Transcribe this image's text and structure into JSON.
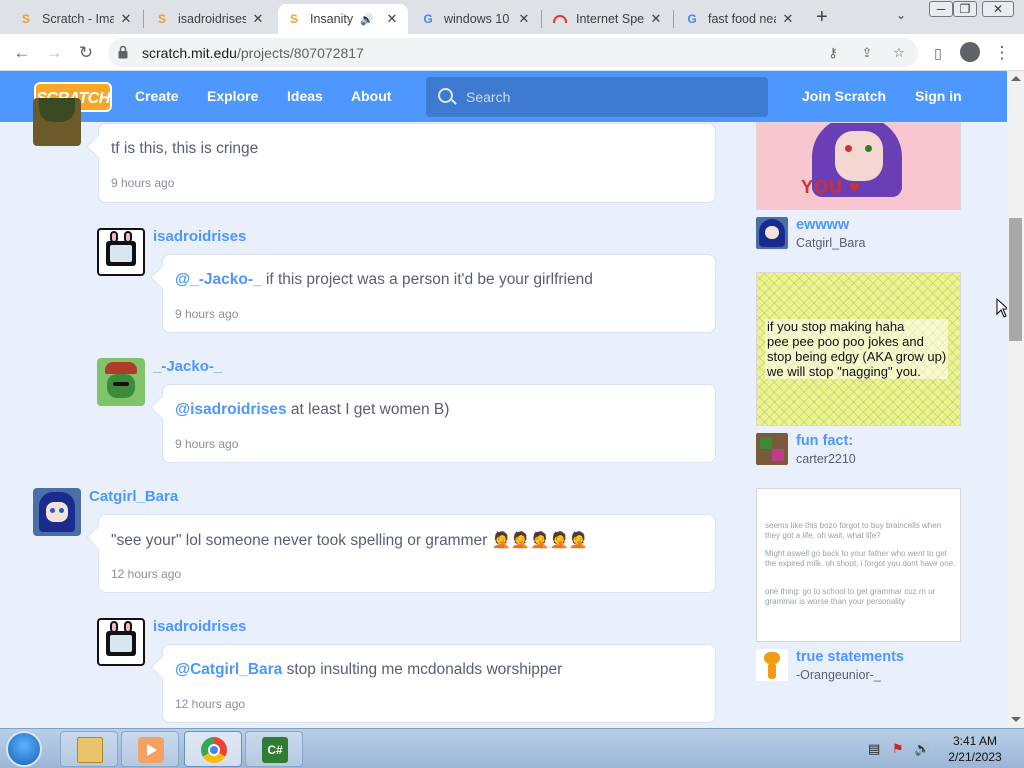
{
  "browser": {
    "tabs": [
      {
        "title": "Scratch - Ima",
        "icon": "scratch-icon",
        "active": false
      },
      {
        "title": "isadroidrises",
        "icon": "scratch-icon",
        "active": false
      },
      {
        "title": "Insanity",
        "icon": "scratch-icon",
        "active": true
      },
      {
        "title": "windows 10",
        "icon": "google-icon",
        "active": false
      },
      {
        "title": "Internet Spe",
        "icon": "speedometer-icon",
        "active": false
      },
      {
        "title": "fast food nea",
        "icon": "google-icon",
        "active": false
      }
    ],
    "url_host": "scratch.mit.edu",
    "url_path": "/projects/807072817"
  },
  "nav": {
    "logo": "SCRATCH",
    "links": [
      "Create",
      "Explore",
      "Ideas",
      "About"
    ],
    "search_placeholder": "Search",
    "join": "Join Scratch",
    "signin": "Sign in"
  },
  "comments": [
    {
      "user": "",
      "mention": "",
      "text": "tf is this, this is cringe",
      "time": "9 hours ago"
    },
    {
      "user": "isadroidrises",
      "mention": "@_-Jacko-_",
      "text": " if this project was a person it'd be your girlfriend",
      "time": "9 hours ago"
    },
    {
      "user": "_-Jacko-_",
      "mention": "@isadroidrises",
      "text": " at least I get women B)",
      "time": "9 hours ago"
    },
    {
      "user": "Catgirl_Bara",
      "mention": "",
      "text": "\"see your\" lol someone never took spelling or grammer 🤦🤦🤦🤦🤦",
      "time": "12 hours ago"
    },
    {
      "user": "isadroidrises",
      "mention": "@Catgirl_Bara",
      "text": " stop insulting me mcdonalds worshipper",
      "time": "12 hours ago"
    }
  ],
  "sidebar": [
    {
      "title": "ewwww",
      "author": "Catgirl_Bara",
      "thumb_text": "YOU ♥"
    },
    {
      "title": "fun fact:",
      "author": "carter2210",
      "thumb_text": "if you stop making haha\npee pee poo poo jokes and\nstop being edgy (AKA grow up)\nwe will stop \"nagging\" you."
    },
    {
      "title": "true statements",
      "author": "-Orangeunior-_",
      "thumb_lines": [
        "seems like this bozo forgot to buy braincells when they got a life. oh wait, what life?",
        "Might aswell go back to your father who went to get the expired milk. oh shoot, i forgot you dont have one.",
        "one thing: go to school to get grammar cuz rn ur grammar is worse than your personality"
      ]
    }
  ],
  "taskbar": {
    "time": "3:41 AM",
    "date": "2/21/2023",
    "apps": [
      "explorer-icon",
      "media-player-icon",
      "chrome-icon",
      "csharp-icon"
    ]
  },
  "colors": {
    "scratch_blue": "#4d97ff",
    "page_bg": "#e9f0fc",
    "logo_orange": "#f9a825"
  }
}
